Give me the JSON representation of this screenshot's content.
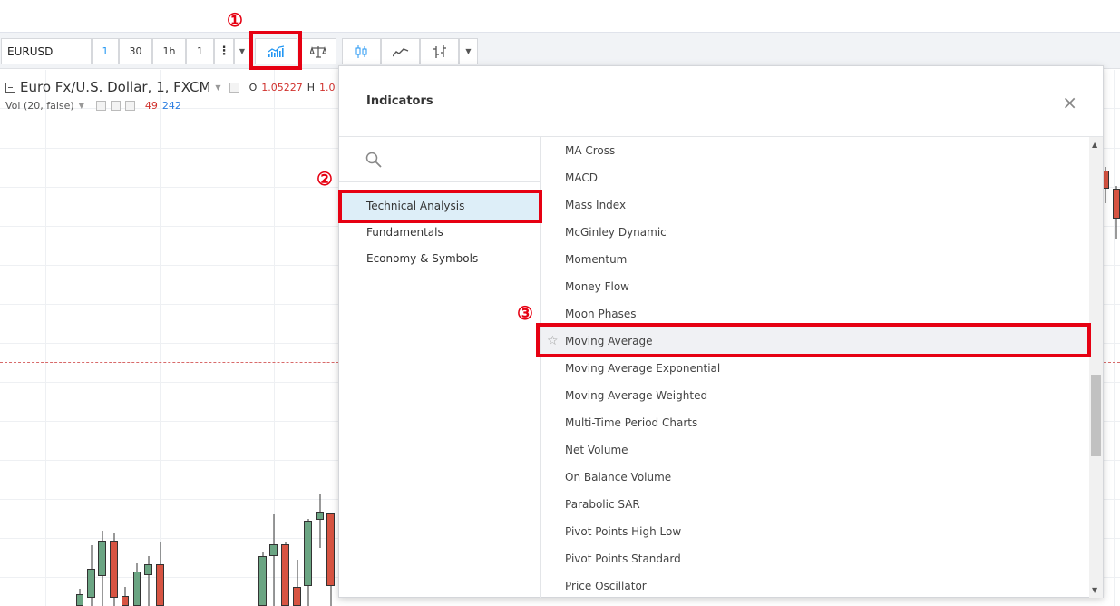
{
  "toolbar": {
    "symbol": "EURUSD",
    "intervals": [
      "1",
      "30",
      "1h",
      "1"
    ],
    "more": "⋮",
    "dropdown_caret": "▼"
  },
  "annotations": [
    "①",
    "②",
    "③"
  ],
  "chart": {
    "title": "Euro Fx/U.S. Dollar, 1, FXCM",
    "ohlc": {
      "o_label": "O",
      "o_value": "1.05227",
      "h_label": "H",
      "h_value": "1.0"
    },
    "volume": {
      "label": "Vol (20, false)",
      "v1": "49",
      "v2": "242"
    }
  },
  "dialog": {
    "title": "Indicators",
    "close": "×",
    "search_placeholder": "",
    "categories": [
      "Technical Analysis",
      "Fundamentals",
      "Economy & Symbols"
    ],
    "selected_category": "Technical Analysis",
    "items": [
      "MA Cross",
      "MACD",
      "Mass Index",
      "McGinley Dynamic",
      "Momentum",
      "Money Flow",
      "Moon Phases",
      "Moving Average",
      "Moving Average Exponential",
      "Moving Average Weighted",
      "Multi-Time Period Charts",
      "Net Volume",
      "On Balance Volume",
      "Parabolic SAR",
      "Pivot Points High Low",
      "Pivot Points Standard",
      "Price Oscillator"
    ],
    "highlighted_item": "Moving Average"
  },
  "colors": {
    "accent": "#2196f3",
    "annotation": "#e60012",
    "up": "#6ba583",
    "down": "#d75442"
  }
}
